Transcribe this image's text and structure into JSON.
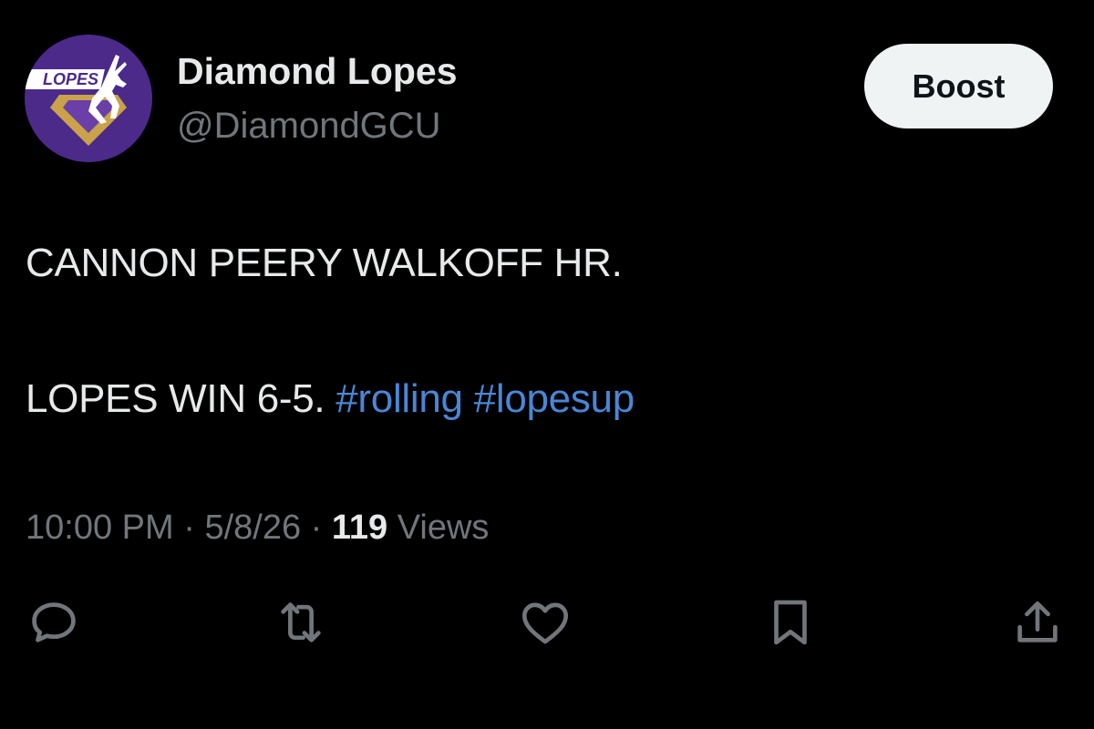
{
  "tweet": {
    "author": {
      "display_name": "Diamond Lopes",
      "handle": "@DiamondGCU",
      "avatar_logo_text": "LOPES"
    },
    "boost_label": "Boost",
    "text_line_1": "CANNON PEERY WALKOFF HR.",
    "text_line_2_plain": "LOPES WIN 6-5. ",
    "hashtags": [
      "#rolling",
      "#lopesup"
    ],
    "meta": {
      "time": "10:00 PM",
      "separator": "·",
      "date": "5/8/26",
      "views_count": "119",
      "views_label": "Views"
    },
    "actions": [
      {
        "name": "reply",
        "icon": "speech-bubble-icon"
      },
      {
        "name": "repost",
        "icon": "repost-arrows-icon"
      },
      {
        "name": "like",
        "icon": "heart-icon"
      },
      {
        "name": "bookmark",
        "icon": "bookmark-icon"
      },
      {
        "name": "share",
        "icon": "share-upload-icon"
      }
    ]
  },
  "colors": {
    "background": "#000000",
    "primary_text": "#e7e9ea",
    "secondary_text": "#71767b",
    "hashtag": "#4a86d6",
    "avatar_purple": "#4b2a8a",
    "avatar_gold": "#c9a24a",
    "boost_button_bg": "#eff3f4"
  }
}
